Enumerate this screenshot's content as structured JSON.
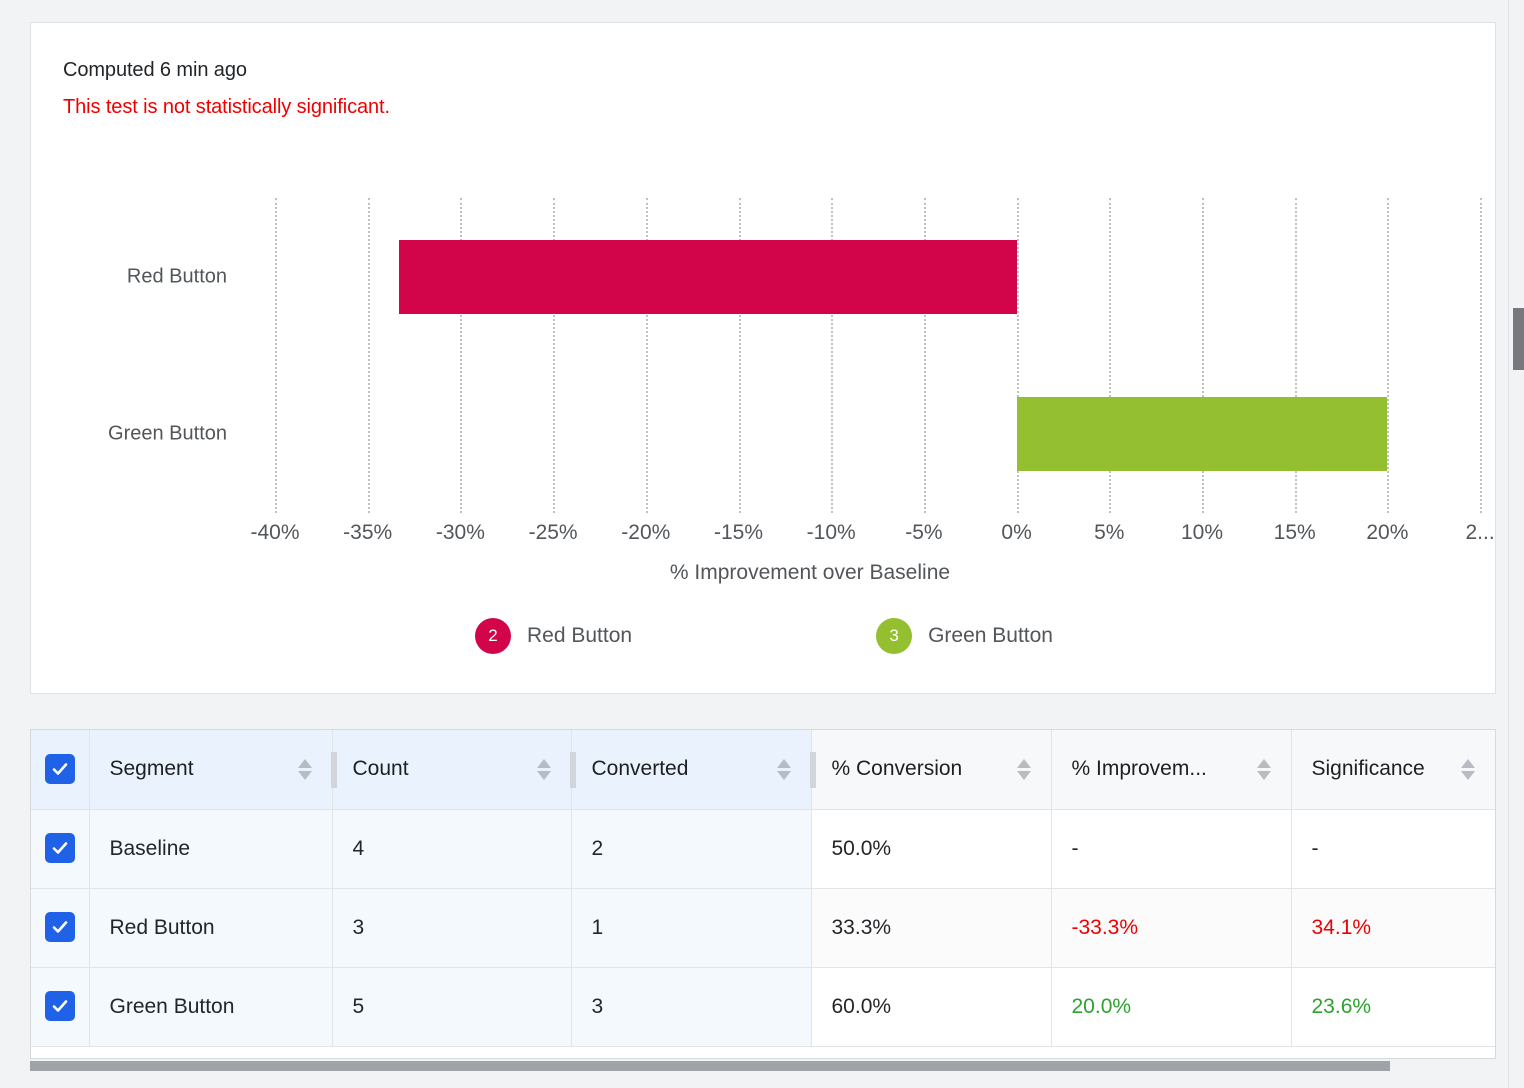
{
  "card": {
    "computed_label": "Computed 6 min ago",
    "significance_note": "This test is not statistically significant.",
    "note_color": "#ef0000"
  },
  "chart_data": {
    "type": "bar",
    "orientation": "horizontal",
    "title": "",
    "xlabel": "% Improvement over Baseline",
    "ylabel": "",
    "categories": [
      "Red Button",
      "Green Button"
    ],
    "values": [
      -33.3,
      20.0
    ],
    "xlim": [
      -42.5,
      22.5
    ],
    "xticks": [
      -40,
      -35,
      -30,
      -25,
      -20,
      -15,
      -10,
      -5,
      0,
      5,
      10,
      15,
      20,
      25
    ],
    "xtick_labels": [
      "-40%",
      "-35%",
      "-30%",
      "-25%",
      "-20%",
      "-15%",
      "-10%",
      "-5%",
      "0%",
      "5%",
      "10%",
      "15%",
      "20%",
      "2..."
    ],
    "grid": true,
    "grid_style": "dotted-vertical",
    "legend_position": "bottom",
    "series": [
      {
        "name": "Red Button",
        "value": -33.3,
        "color": "#d3054a",
        "badge": "2"
      },
      {
        "name": "Green Button",
        "value": 20.0,
        "color": "#93bf31",
        "badge": "3"
      }
    ]
  },
  "table": {
    "select_all_checked": true,
    "columns": [
      {
        "key": "segment",
        "label": "Segment",
        "sortable": true,
        "group": "sel"
      },
      {
        "key": "count",
        "label": "Count",
        "sortable": true,
        "group": "sel"
      },
      {
        "key": "converted",
        "label": "Converted",
        "sortable": true,
        "group": "sel"
      },
      {
        "key": "pct_conversion",
        "label": "% Conversion",
        "sortable": true,
        "group": "plain"
      },
      {
        "key": "pct_improvement",
        "label": "% Improvem...",
        "sortable": true,
        "group": "plain"
      },
      {
        "key": "significance",
        "label": "Significance",
        "sortable": true,
        "group": "plain"
      }
    ],
    "rows": [
      {
        "checked": true,
        "segment": "Baseline",
        "count": "4",
        "converted": "2",
        "pct_conversion": "50.0%",
        "pct_improvement": "-",
        "significance": "-",
        "improvement_state": "neutral",
        "significance_state": "neutral"
      },
      {
        "checked": true,
        "segment": "Red Button",
        "count": "3",
        "converted": "1",
        "pct_conversion": "33.3%",
        "pct_improvement": "-33.3%",
        "significance": "34.1%",
        "improvement_state": "negative",
        "significance_state": "negative"
      },
      {
        "checked": true,
        "segment": "Green Button",
        "count": "5",
        "converted": "3",
        "pct_conversion": "60.0%",
        "pct_improvement": "20.0%",
        "significance": "23.6%",
        "improvement_state": "positive",
        "significance_state": "positive"
      }
    ]
  },
  "colors": {
    "positive": "#2ca32c",
    "negative": "#ef0000",
    "checkbox": "#1f62e8",
    "red_series": "#d3054a",
    "green_series": "#93bf31"
  }
}
